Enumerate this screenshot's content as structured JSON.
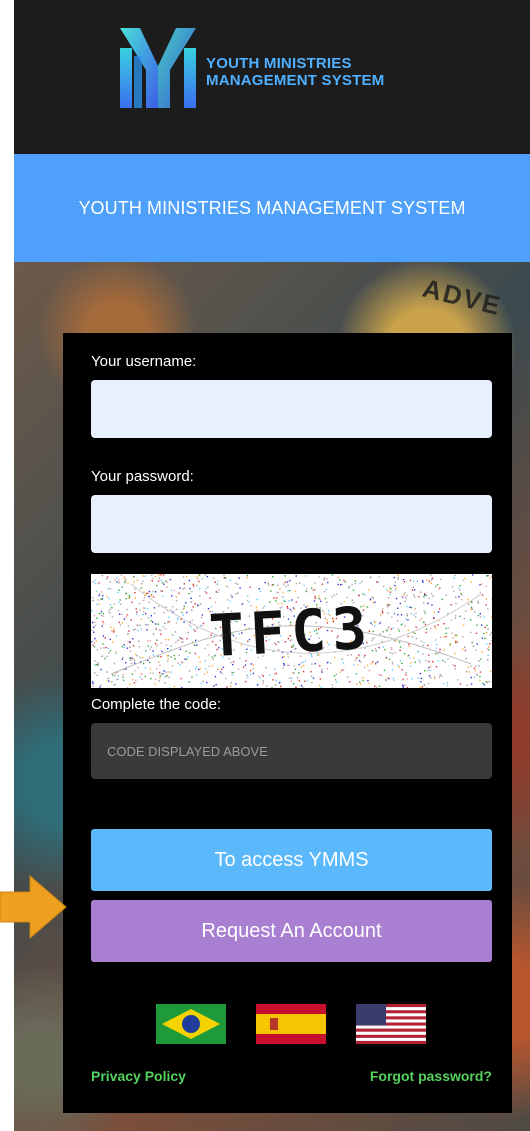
{
  "header": {
    "logo_line1": "YOUTH MINISTRIES",
    "logo_line2": "MANAGEMENT SYSTEM"
  },
  "banner": {
    "title": "YOUTH MINISTRIES MANAGEMENT SYSTEM"
  },
  "background": {
    "sign_text": "ADVE"
  },
  "form": {
    "username_label": "Your username:",
    "username_value": "",
    "password_label": "Your password:",
    "password_value": "",
    "captcha_text": "TFC3",
    "code_label": "Complete the code:",
    "code_placeholder": "CODE DISPLAYED ABOVE",
    "access_button": "To access YMMS",
    "request_button": "Request An Account"
  },
  "languages": [
    {
      "name": "brazil-flag"
    },
    {
      "name": "spain-flag"
    },
    {
      "name": "usa-flag"
    }
  ],
  "links": {
    "privacy": "Privacy Policy",
    "forgot": "Forgot password?"
  },
  "colors": {
    "topbar": "#1c1c1c",
    "banner": "#4ea0fb",
    "access_button": "#5ab8fb",
    "request_button": "#a97fd2",
    "link": "#56d15e",
    "arrow": "#f0a020"
  },
  "icons": {
    "logo": "ymms-logo-icon",
    "pointer": "arrow-right-icon"
  }
}
